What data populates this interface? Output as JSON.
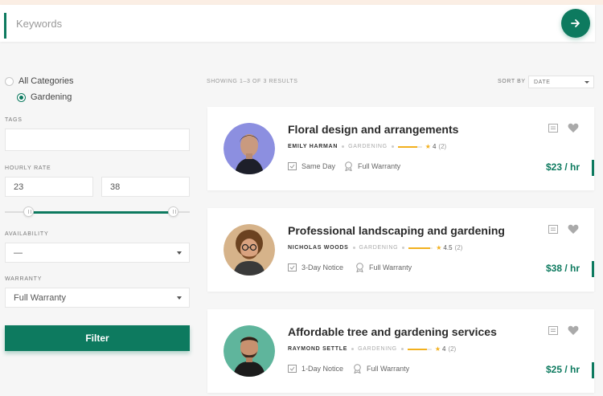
{
  "search": {
    "placeholder": "Keywords"
  },
  "colors": {
    "accent": "#0d7a5f",
    "star": "#f2b01e"
  },
  "sidebar": {
    "categories": [
      {
        "label": "All Categories",
        "selected": false
      },
      {
        "label": "Gardening",
        "selected": true
      }
    ],
    "tags_label": "TAGS",
    "hourly_rate_label": "HOURLY RATE",
    "rate_min": "23",
    "rate_max": "38",
    "slider_range": {
      "low": 0.13,
      "high": 0.91
    },
    "availability_label": "AVAILABILITY",
    "availability_value": "—",
    "warranty_label": "WARRANTY",
    "warranty_value": "Full Warranty",
    "filter_button": "Filter"
  },
  "results": {
    "showing_text": "SHOWING 1–3 OF 3 RESULTS",
    "sort_label": "SORT BY",
    "sort_value": "DATE"
  },
  "listings": [
    {
      "title": "Floral design and arrangements",
      "provider": "EMILY HARMAN",
      "category": "GARDENING",
      "rating": "4",
      "rating_fraction": 0.8,
      "reviews": "(2)",
      "notice": "Same Day",
      "warranty": "Full Warranty",
      "price": "$23 / hr"
    },
    {
      "title": "Professional landscaping and gardening",
      "provider": "NICHOLAS WOODS",
      "category": "GARDENING",
      "rating": "4.5",
      "rating_fraction": 0.9,
      "reviews": "(2)",
      "notice": "3-Day Notice",
      "warranty": "Full Warranty",
      "price": "$38 / hr"
    },
    {
      "title": "Affordable tree and gardening services",
      "provider": "RAYMOND SETTLE",
      "category": "GARDENING",
      "rating": "4",
      "rating_fraction": 0.8,
      "reviews": "(2)",
      "notice": "1-Day Notice",
      "warranty": "Full Warranty",
      "price": "$25 / hr"
    }
  ]
}
